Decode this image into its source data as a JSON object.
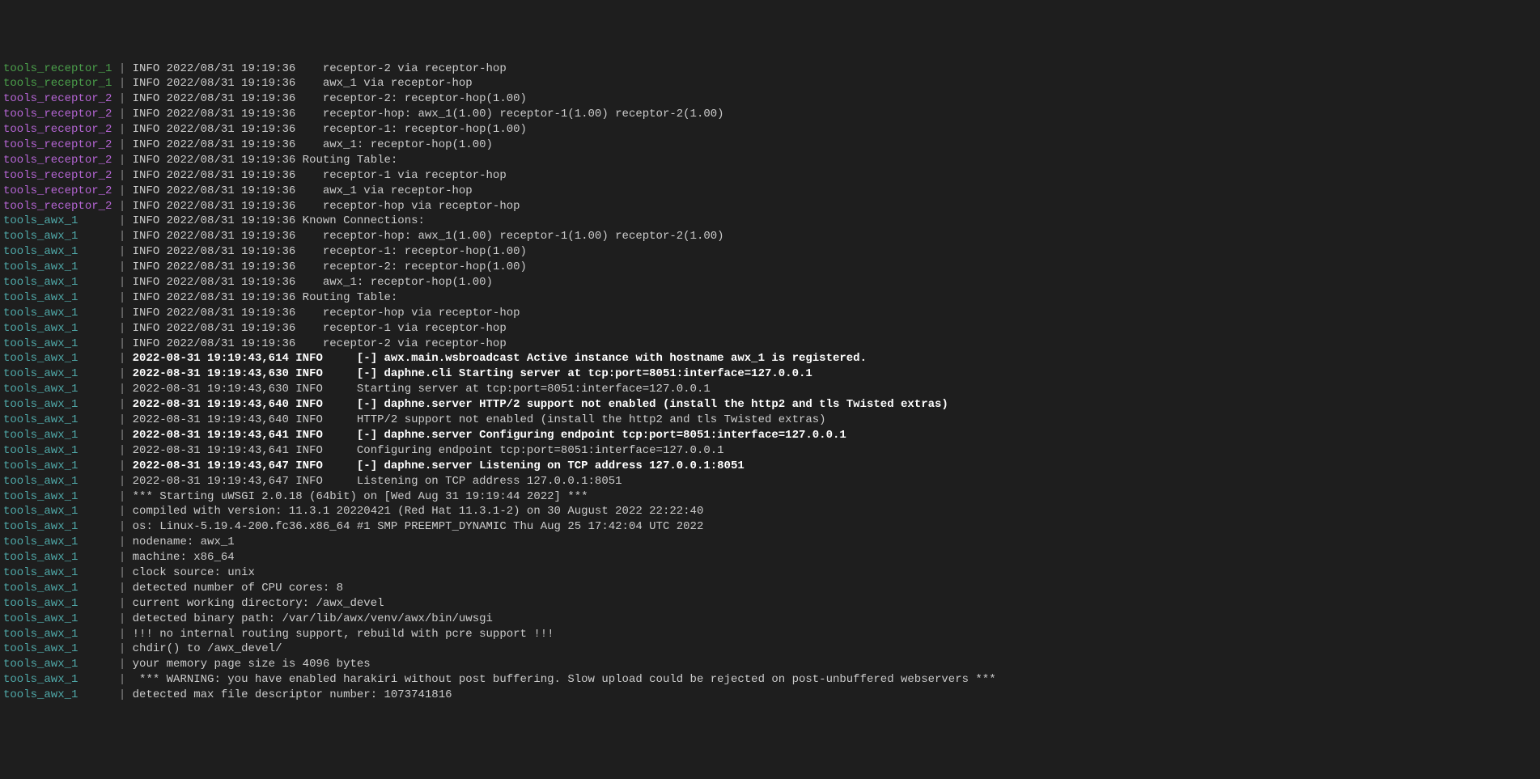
{
  "colors": {
    "receptor_1": "#4a9e4a",
    "receptor_2": "#b565d4",
    "awx_1": "#4fa8a8",
    "separator": "#888888",
    "bg": "#1e1e1e"
  },
  "lines": [
    {
      "src": "tools_receptor_1",
      "srcClass": "source-receptor-1",
      "bold": false,
      "msg": "INFO 2022/08/31 19:19:36    receptor-2 via receptor-hop"
    },
    {
      "src": "tools_receptor_1",
      "srcClass": "source-receptor-1",
      "bold": false,
      "msg": "INFO 2022/08/31 19:19:36    awx_1 via receptor-hop"
    },
    {
      "src": "tools_receptor_2",
      "srcClass": "source-receptor-2",
      "bold": false,
      "msg": "INFO 2022/08/31 19:19:36    receptor-2: receptor-hop(1.00)"
    },
    {
      "src": "tools_receptor_2",
      "srcClass": "source-receptor-2",
      "bold": false,
      "msg": "INFO 2022/08/31 19:19:36    receptor-hop: awx_1(1.00) receptor-1(1.00) receptor-2(1.00)"
    },
    {
      "src": "tools_receptor_2",
      "srcClass": "source-receptor-2",
      "bold": false,
      "msg": "INFO 2022/08/31 19:19:36    receptor-1: receptor-hop(1.00)"
    },
    {
      "src": "tools_receptor_2",
      "srcClass": "source-receptor-2",
      "bold": false,
      "msg": "INFO 2022/08/31 19:19:36    awx_1: receptor-hop(1.00)"
    },
    {
      "src": "tools_receptor_2",
      "srcClass": "source-receptor-2",
      "bold": false,
      "msg": "INFO 2022/08/31 19:19:36 Routing Table:"
    },
    {
      "src": "tools_receptor_2",
      "srcClass": "source-receptor-2",
      "bold": false,
      "msg": "INFO 2022/08/31 19:19:36    receptor-1 via receptor-hop"
    },
    {
      "src": "tools_receptor_2",
      "srcClass": "source-receptor-2",
      "bold": false,
      "msg": "INFO 2022/08/31 19:19:36    awx_1 via receptor-hop"
    },
    {
      "src": "tools_receptor_2",
      "srcClass": "source-receptor-2",
      "bold": false,
      "msg": "INFO 2022/08/31 19:19:36    receptor-hop via receptor-hop"
    },
    {
      "src": "tools_awx_1     ",
      "srcClass": "source-awx-1",
      "bold": false,
      "msg": "INFO 2022/08/31 19:19:36 Known Connections:"
    },
    {
      "src": "tools_awx_1     ",
      "srcClass": "source-awx-1",
      "bold": false,
      "msg": "INFO 2022/08/31 19:19:36    receptor-hop: awx_1(1.00) receptor-1(1.00) receptor-2(1.00)"
    },
    {
      "src": "tools_awx_1     ",
      "srcClass": "source-awx-1",
      "bold": false,
      "msg": "INFO 2022/08/31 19:19:36    receptor-1: receptor-hop(1.00)"
    },
    {
      "src": "tools_awx_1     ",
      "srcClass": "source-awx-1",
      "bold": false,
      "msg": "INFO 2022/08/31 19:19:36    receptor-2: receptor-hop(1.00)"
    },
    {
      "src": "tools_awx_1     ",
      "srcClass": "source-awx-1",
      "bold": false,
      "msg": "INFO 2022/08/31 19:19:36    awx_1: receptor-hop(1.00)"
    },
    {
      "src": "tools_awx_1     ",
      "srcClass": "source-awx-1",
      "bold": false,
      "msg": "INFO 2022/08/31 19:19:36 Routing Table:"
    },
    {
      "src": "tools_awx_1     ",
      "srcClass": "source-awx-1",
      "bold": false,
      "msg": "INFO 2022/08/31 19:19:36    receptor-hop via receptor-hop"
    },
    {
      "src": "tools_awx_1     ",
      "srcClass": "source-awx-1",
      "bold": false,
      "msg": "INFO 2022/08/31 19:19:36    receptor-1 via receptor-hop"
    },
    {
      "src": "tools_awx_1     ",
      "srcClass": "source-awx-1",
      "bold": false,
      "msg": "INFO 2022/08/31 19:19:36    receptor-2 via receptor-hop"
    },
    {
      "src": "tools_awx_1     ",
      "srcClass": "source-awx-1",
      "bold": true,
      "msg": "2022-08-31 19:19:43,614 INFO     [-] awx.main.wsbroadcast Active instance with hostname awx_1 is registered."
    },
    {
      "src": "tools_awx_1     ",
      "srcClass": "source-awx-1",
      "bold": true,
      "msg": "2022-08-31 19:19:43,630 INFO     [-] daphne.cli Starting server at tcp:port=8051:interface=127.0.0.1"
    },
    {
      "src": "tools_awx_1     ",
      "srcClass": "source-awx-1",
      "bold": false,
      "msg": "2022-08-31 19:19:43,630 INFO     Starting server at tcp:port=8051:interface=127.0.0.1"
    },
    {
      "src": "tools_awx_1     ",
      "srcClass": "source-awx-1",
      "bold": true,
      "msg": "2022-08-31 19:19:43,640 INFO     [-] daphne.server HTTP/2 support not enabled (install the http2 and tls Twisted extras)"
    },
    {
      "src": "tools_awx_1     ",
      "srcClass": "source-awx-1",
      "bold": false,
      "msg": "2022-08-31 19:19:43,640 INFO     HTTP/2 support not enabled (install the http2 and tls Twisted extras)"
    },
    {
      "src": "tools_awx_1     ",
      "srcClass": "source-awx-1",
      "bold": true,
      "msg": "2022-08-31 19:19:43,641 INFO     [-] daphne.server Configuring endpoint tcp:port=8051:interface=127.0.0.1"
    },
    {
      "src": "tools_awx_1     ",
      "srcClass": "source-awx-1",
      "bold": false,
      "msg": "2022-08-31 19:19:43,641 INFO     Configuring endpoint tcp:port=8051:interface=127.0.0.1"
    },
    {
      "src": "tools_awx_1     ",
      "srcClass": "source-awx-1",
      "bold": true,
      "msg": "2022-08-31 19:19:43,647 INFO     [-] daphne.server Listening on TCP address 127.0.0.1:8051"
    },
    {
      "src": "tools_awx_1     ",
      "srcClass": "source-awx-1",
      "bold": false,
      "msg": "2022-08-31 19:19:43,647 INFO     Listening on TCP address 127.0.0.1:8051"
    },
    {
      "src": "tools_awx_1     ",
      "srcClass": "source-awx-1",
      "bold": false,
      "msg": "*** Starting uWSGI 2.0.18 (64bit) on [Wed Aug 31 19:19:44 2022] ***"
    },
    {
      "src": "tools_awx_1     ",
      "srcClass": "source-awx-1",
      "bold": false,
      "msg": "compiled with version: 11.3.1 20220421 (Red Hat 11.3.1-2) on 30 August 2022 22:22:40"
    },
    {
      "src": "tools_awx_1     ",
      "srcClass": "source-awx-1",
      "bold": false,
      "msg": "os: Linux-5.19.4-200.fc36.x86_64 #1 SMP PREEMPT_DYNAMIC Thu Aug 25 17:42:04 UTC 2022"
    },
    {
      "src": "tools_awx_1     ",
      "srcClass": "source-awx-1",
      "bold": false,
      "msg": "nodename: awx_1"
    },
    {
      "src": "tools_awx_1     ",
      "srcClass": "source-awx-1",
      "bold": false,
      "msg": "machine: x86_64"
    },
    {
      "src": "tools_awx_1     ",
      "srcClass": "source-awx-1",
      "bold": false,
      "msg": "clock source: unix"
    },
    {
      "src": "tools_awx_1     ",
      "srcClass": "source-awx-1",
      "bold": false,
      "msg": "detected number of CPU cores: 8"
    },
    {
      "src": "tools_awx_1     ",
      "srcClass": "source-awx-1",
      "bold": false,
      "msg": "current working directory: /awx_devel"
    },
    {
      "src": "tools_awx_1     ",
      "srcClass": "source-awx-1",
      "bold": false,
      "msg": "detected binary path: /var/lib/awx/venv/awx/bin/uwsgi"
    },
    {
      "src": "tools_awx_1     ",
      "srcClass": "source-awx-1",
      "bold": false,
      "msg": "!!! no internal routing support, rebuild with pcre support !!!"
    },
    {
      "src": "tools_awx_1     ",
      "srcClass": "source-awx-1",
      "bold": false,
      "msg": "chdir() to /awx_devel/"
    },
    {
      "src": "tools_awx_1     ",
      "srcClass": "source-awx-1",
      "bold": false,
      "msg": "your memory page size is 4096 bytes"
    },
    {
      "src": "tools_awx_1     ",
      "srcClass": "source-awx-1",
      "bold": false,
      "msg": " *** WARNING: you have enabled harakiri without post buffering. Slow upload could be rejected on post-unbuffered webservers ***"
    },
    {
      "src": "tools_awx_1     ",
      "srcClass": "source-awx-1",
      "bold": false,
      "msg": "detected max file descriptor number: 1073741816"
    }
  ],
  "separator": " | "
}
